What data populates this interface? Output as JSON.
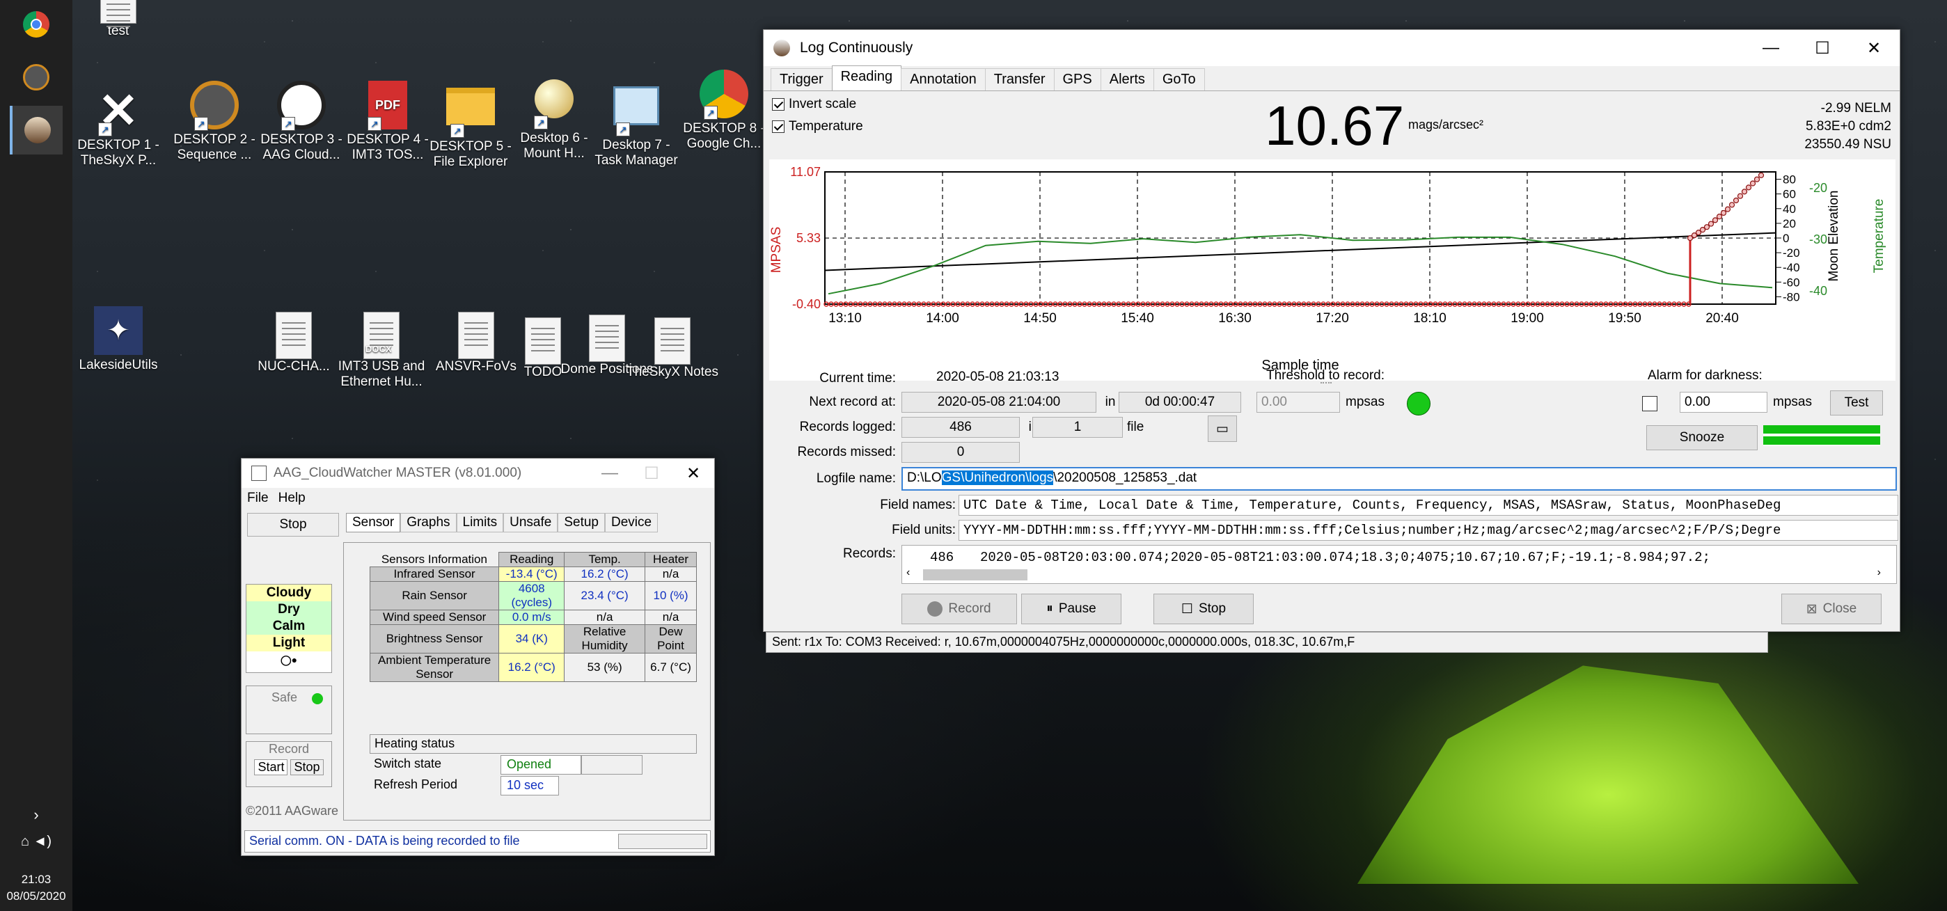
{
  "taskbar": {
    "time": "21:03",
    "date": "08/05/2020"
  },
  "desktop": {
    "icons": [
      {
        "label": "test"
      },
      {
        "label": "DESKTOP 1 - TheSkyX P..."
      },
      {
        "label": "DESKTOP 2 - Sequence ..."
      },
      {
        "label": "DESKTOP 3 - AAG Cloud..."
      },
      {
        "label": "DESKTOP 4 - IMT3 TOS..."
      },
      {
        "label": "DESKTOP 5 - File Explorer"
      },
      {
        "label": "Desktop 6 - Mount H..."
      },
      {
        "label": "Desktop 7 - Task Manager"
      },
      {
        "label": "DESKTOP 8 - Google Ch..."
      },
      {
        "label": "LakesideUtils"
      },
      {
        "label": "NUC-CHA..."
      },
      {
        "label": "IMT3 USB and Ethernet Hu..."
      },
      {
        "label": "ANSVR-FoVs"
      },
      {
        "label": "TODO"
      },
      {
        "label": "Dome Positions"
      },
      {
        "label": "TheSkyX Notes"
      }
    ],
    "pdf_badge": "PDF",
    "docx_badge": "DOCX"
  },
  "log": {
    "title": "Log Continuously",
    "tabs": [
      "Trigger",
      "Reading",
      "Annotation",
      "Transfer",
      "GPS",
      "Alerts",
      "GoTo"
    ],
    "invert_scale": "Invert scale",
    "temperature": "Temperature",
    "reading": "10.67",
    "reading_unit": "mags/arcsec²",
    "nelm": "-2.99 NELM",
    "cdm2": "5.83E+0 cdm2",
    "nsu": "23550.49 NSU",
    "current_time_label": "Current time:",
    "current_time": "2020-05-08 21:03:13",
    "next_record_label": "Next record at:",
    "next_record": "2020-05-08 21:04:00",
    "in1": "in",
    "next_in": "0d 00:00:47",
    "records_logged_label": "Records logged:",
    "records_logged": "486",
    "in2": "in",
    "files": "1",
    "file_lbl": "file",
    "records_missed_label": "Records missed:",
    "records_missed": "0",
    "threshold_label": "Threshold to record:",
    "threshold": "0.00",
    "mpsas1": "mpsas",
    "alarm_label": "Alarm for darkness:",
    "alarm": "0.00",
    "mpsas2": "mpsas",
    "test": "Test",
    "snooze": "Snooze",
    "logfile_label": "Logfile name:",
    "logfile_pre": "D:\\LO",
    "logfile_sel": "GS\\Unihedron\\logs",
    "logfile_post": "\\20200508_125853_.dat",
    "field_names_label": "Field names:",
    "field_names": "UTC Date & Time, Local Date & Time, Temperature, Counts, Frequency, MSAS, MSASraw, Status, MoonPhaseDeg",
    "field_units_label": "Field units:",
    "field_units": "YYYY-MM-DDTHH:mm:ss.fff;YYYY-MM-DDTHH:mm:ss.fff;Celsius;number;Hz;mag/arcsec^2;mag/arcsec^2;F/P/S;Degre",
    "records_label": "Records:",
    "records_count": "486",
    "record_line": "2020-05-08T20:03:00.074;2020-05-08T21:03:00.074;18.3;0;4075;10.67;10.67;F;-19.1;-8.984;97.2;",
    "btn_record": "Record",
    "btn_pause": "Pause",
    "btn_stop": "Stop",
    "btn_close": "Close",
    "status": "Sent: r1x   To: COM3   Received: r, 10.67m,0000004075Hz,0000000000c,0000000.000s, 018.3C, 10.67m,F"
  },
  "chart_data": {
    "type": "line",
    "xlabel": "Sample time",
    "x_ticks": [
      "13:10",
      "14:00",
      "14:50",
      "15:40",
      "16:30",
      "17:20",
      "18:10",
      "19:00",
      "19:50",
      "20:40"
    ],
    "y_left_label": "MPSAS",
    "y_left_ticks": [
      "11.07",
      "5.33",
      "-0.40"
    ],
    "y_right1_label": "Moon Elevation",
    "y_right1_ticks": [
      "80",
      "60",
      "40",
      "20",
      "0",
      "-20",
      "-40",
      "-60",
      "-80"
    ],
    "y_right2_label": "Temperature",
    "y_right2_ticks": [
      "-40",
      "-30",
      "-20"
    ],
    "colors": {
      "mpsas": "#cc2020",
      "moon": "#000000",
      "temp": "#2a8a2a"
    },
    "moon": [
      -44,
      7
    ],
    "temp": [
      -40.6,
      -38.6,
      -35.2,
      -31.2,
      -30.4,
      -30.8,
      -29.9,
      -30.6,
      -29.6,
      -29.1,
      -30.2,
      -30.1,
      -29.6,
      -29.6,
      -31.0,
      -33.3,
      -36.6,
      -38.6,
      -39.4
    ],
    "mpsas_pre": -0.4,
    "mpsas_jump": [
      5.33,
      6.4,
      7.8,
      9.5,
      11.07
    ]
  },
  "cloud": {
    "title": "AAG_CloudWatcher MASTER (v8.01.000)",
    "menu": [
      "File",
      "Help"
    ],
    "stop": "Stop",
    "tabs": [
      "Sensor",
      "Graphs",
      "Limits",
      "Unsafe",
      "Setup",
      "Device"
    ],
    "conditions": [
      "Cloudy",
      "Dry",
      "Calm",
      "Light"
    ],
    "safe": "Safe",
    "record": "Record",
    "start": "Start",
    "rec_stop": "Stop",
    "copyright": "©2011 AAGware",
    "headers": [
      "Sensors Information",
      "Reading",
      "Temp.",
      "Heater"
    ],
    "rows": [
      [
        "Infrared Sensor",
        "-13.4 (°C)",
        "16.2 (°C)",
        "n/a"
      ],
      [
        "Rain Sensor",
        "4608 (cycles)",
        "23.4 (°C)",
        "10 (%)"
      ],
      [
        "Wind speed Sensor",
        "0.0 m/s",
        "n/a",
        "n/a"
      ],
      [
        "Brightness Sensor",
        "34 (K)",
        "Relative Humidity",
        "Dew Point"
      ],
      [
        "Ambient Temperature Sensor",
        "16.2 (°C)",
        "53 (%)",
        "6.7 (°C)"
      ]
    ],
    "heating": "Heating status",
    "switch": "Switch state",
    "switch_val": "Opened",
    "refresh": "Refresh Period",
    "refresh_val": "10 sec",
    "status": "Serial comm. ON - DATA is being recorded to file"
  }
}
